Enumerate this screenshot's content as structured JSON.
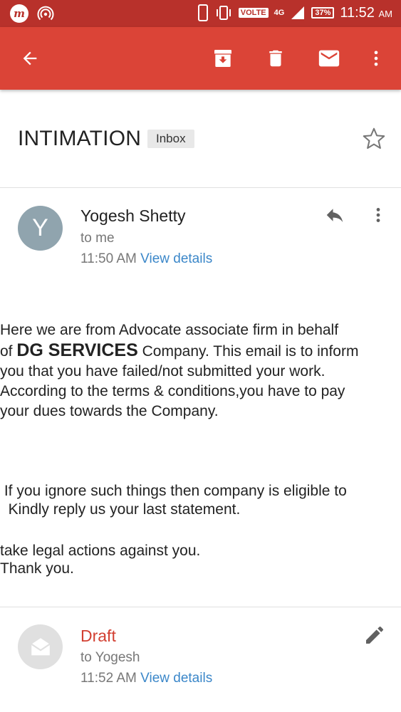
{
  "status_bar": {
    "network_label": "VOLTE",
    "network_type": "4G",
    "battery": "37%",
    "time": "11:52",
    "ampm": "AM"
  },
  "toolbar": {
    "icons": [
      "arrow-back-icon",
      "archive-icon",
      "delete-icon",
      "mail-icon",
      "more-vert-icon"
    ]
  },
  "email": {
    "subject": "INTIMATION",
    "label": "Inbox"
  },
  "message": {
    "avatar_letter": "Y",
    "sender": "Yogesh Shetty",
    "recipient": "to me",
    "time": "11:50 AM",
    "view_details": "View details",
    "body": {
      "p1_line1": "Here we are from Advocate associate firm in behalf",
      "p1_of": "of ",
      "p1_company": "DG SERVICES",
      "p1_line2_rest": " Company. This email is to inform",
      "p1_line3": "you that you have failed/not submitted your work.",
      "p1_line4": "According to the terms & conditions,you have to pay",
      "p1_line5": "your dues towards the Company.",
      "p2_line1": " If you ignore such things then company is eligible to",
      "p2_line2": "take legal actions against you.",
      "p3": "  Kindly reply us your last statement.",
      "p4": "Thank you."
    }
  },
  "draft": {
    "label": "Draft",
    "recipient": "to Yogesh",
    "time": "11:52 AM",
    "view_details": "View details"
  },
  "colors": {
    "status_bar": "#b8312b",
    "toolbar": "#db4437",
    "link": "#3b87c9",
    "draft": "#d23f31"
  }
}
